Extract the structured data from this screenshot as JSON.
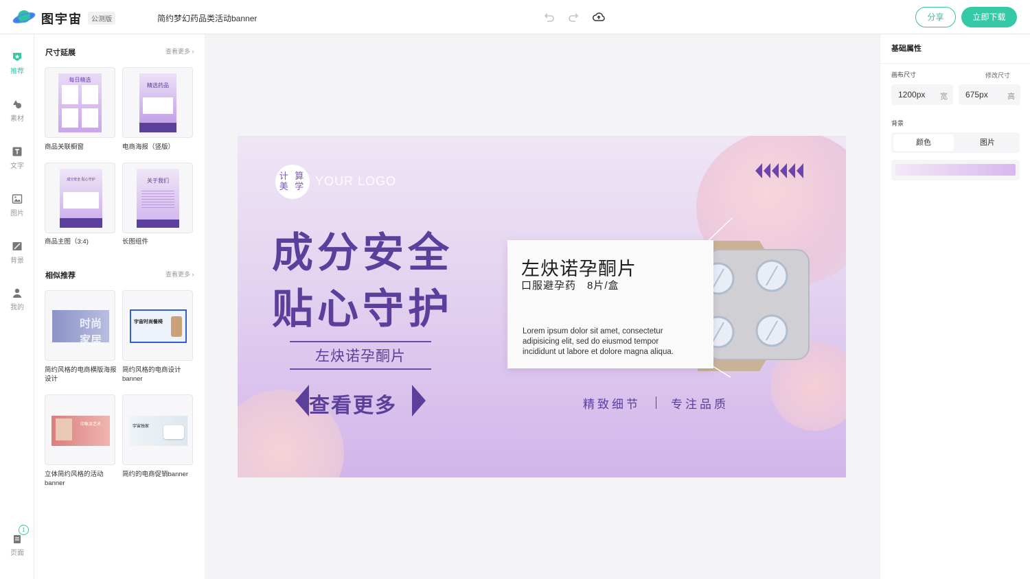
{
  "header": {
    "brand": "图宇宙",
    "badge": "公测版",
    "doc_title": "简约梦幻药品类活动banner",
    "share_label": "分享",
    "download_label": "立即下载"
  },
  "nav": [
    {
      "label": "推荐",
      "icon": "star-shield-icon"
    },
    {
      "label": "素材",
      "icon": "shapes-icon"
    },
    {
      "label": "文字",
      "icon": "text-icon"
    },
    {
      "label": "图片",
      "icon": "image-icon"
    },
    {
      "label": "背景",
      "icon": "background-icon"
    },
    {
      "label": "我的",
      "icon": "user-icon"
    },
    {
      "label": "页面",
      "icon": "pages-icon",
      "badge": "1"
    }
  ],
  "panel": {
    "section1": {
      "title": "尺寸延展",
      "more": "查看更多",
      "items": [
        {
          "label": "商品关联橱窗",
          "thumb_text": "每日精选"
        },
        {
          "label": "电商海报（竖版）",
          "thumb_text": "精选药品"
        },
        {
          "label": "商品主图（3:4)",
          "thumb_text": "成分安全 贴心守护"
        },
        {
          "label": "长图组件",
          "thumb_text": "关于我们"
        }
      ]
    },
    "section2": {
      "title": "相似推荐",
      "more": "查看更多",
      "items": [
        {
          "label": "简约风格的电商横版海报设计",
          "thumb_text": "时尚家居"
        },
        {
          "label": "简约风格的电商设计banner",
          "thumb_text": "宇宙时尚餐椅"
        },
        {
          "label": "立体简约风格的活动banner",
          "thumb_text": "印象派艺术"
        },
        {
          "label": "简约的电商促销banner",
          "thumb_text": "宇宙独家"
        }
      ]
    }
  },
  "canvas": {
    "logo_text": "计算美学",
    "logo_text_line1": "计 算",
    "logo_text_line2": "美 学",
    "your_logo": "YOUR LOGO",
    "headline1": "成分安全",
    "headline2": "贴心守护",
    "subtitle": "左炔诺孕酮片",
    "cta": "查看更多",
    "card_title": "左炔诺孕酮片",
    "card_subtitle": "口服避孕药　8片/盒",
    "card_body": "Lorem ipsum dolor sit amet, consectetur adipisicing elit, sed do eiusmod tempor incididunt ut labore et dolore magna aliqua.",
    "tagline_left": "精致细节",
    "tagline_right": "专注品质",
    "colors": {
      "primary": "#5b3f9a",
      "bg_top": "#efe6f5",
      "bg_bottom": "#d2b5ea"
    }
  },
  "props": {
    "title": "基础属性",
    "canvas_size_label": "画布尺寸",
    "resize_label": "修改尺寸",
    "width_value": "1200px",
    "width_unit": "宽",
    "height_value": "675px",
    "height_unit": "高",
    "background_label": "背景",
    "bg_tab_color": "颜色",
    "bg_tab_image": "图片",
    "bg_gradient_from": "#f3e9f7",
    "bg_gradient_to": "#d9b7ef"
  },
  "theme": {
    "accent": "#36c9a6"
  }
}
